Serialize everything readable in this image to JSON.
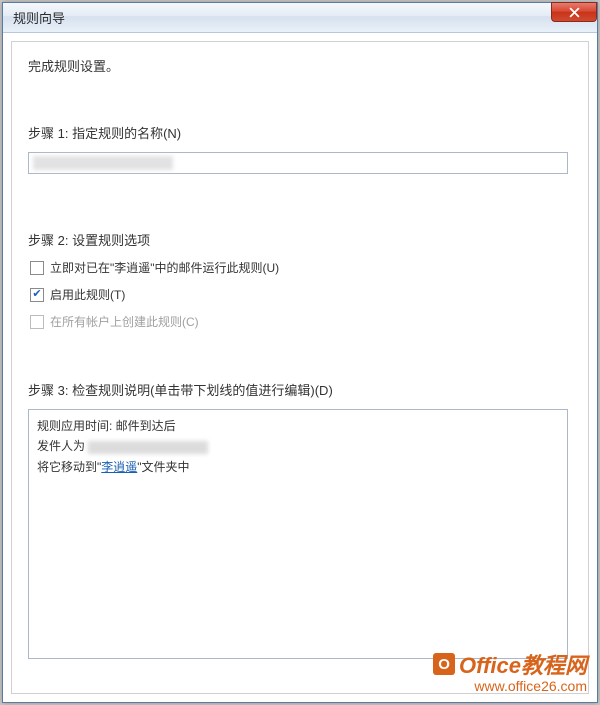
{
  "window": {
    "title": "规则向导"
  },
  "heading": "完成规则设置。",
  "step1": {
    "label": "步骤 1: 指定规则的名称(N)",
    "value": ""
  },
  "step2": {
    "label": "步骤 2: 设置规则选项",
    "opt1": {
      "checked": false,
      "label": "立即对已在\"李逍遥\"中的邮件运行此规则(U)"
    },
    "opt2": {
      "checked": true,
      "label": "启用此规则(T)"
    },
    "opt3": {
      "checked": false,
      "disabled": true,
      "label": "在所有帐户上创建此规则(C)"
    }
  },
  "step3": {
    "label": "步骤 3: 检查规则说明(单击带下划线的值进行编辑)(D)",
    "line1": "规则应用时间: 邮件到达后",
    "line2_prefix": "发件人为",
    "line3_prefix": "将它移动到\"",
    "line3_link": "李逍遥",
    "line3_suffix": "\"文件夹中"
  },
  "watermark": {
    "line1": "Office教程网",
    "line2": "www.office26.com"
  }
}
